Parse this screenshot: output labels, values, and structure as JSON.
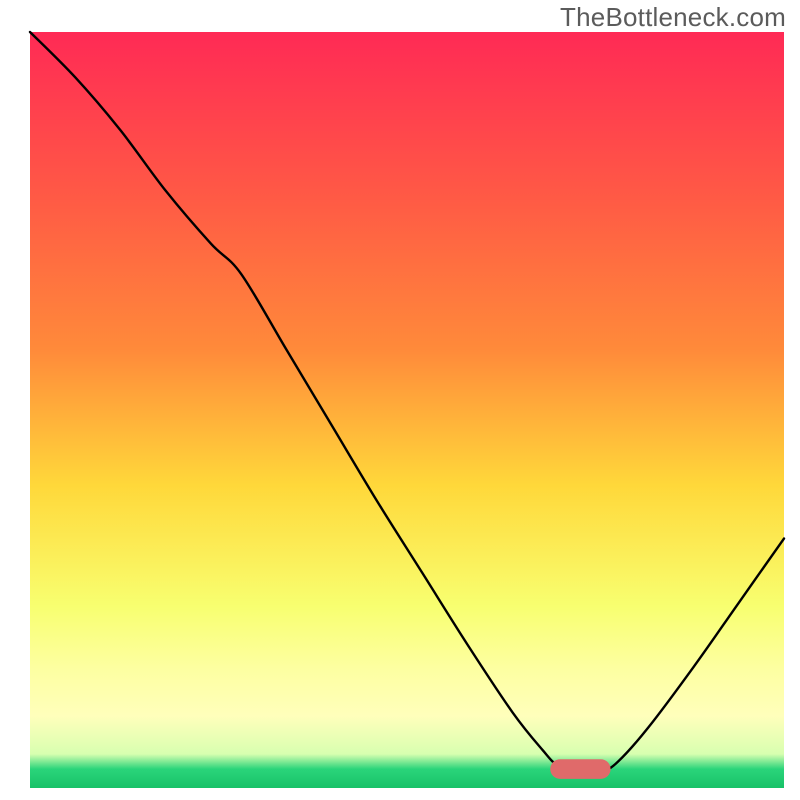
{
  "watermark": "TheBottleneck.com",
  "chart_data": {
    "type": "line",
    "title": "",
    "xlabel": "",
    "ylabel": "",
    "xlim": [
      0,
      100
    ],
    "ylim": [
      0,
      100
    ],
    "grid": false,
    "axes_visible": false,
    "background_gradient": {
      "top_color": "#ff2a55",
      "upper_mid_color": "#ff8a3a",
      "mid_color": "#ffd83a",
      "lower_mid_color": "#f8ff70",
      "pale_band_color": "#ffffbb",
      "thin_green_color": "#2ad47a",
      "bottom_band_color": "#18c268"
    },
    "marker": {
      "x": 73,
      "y": 2.5,
      "width": 8,
      "height": 2.6,
      "color": "#e06a6a",
      "rounded": true
    },
    "series": [
      {
        "name": "curve",
        "color": "#000000",
        "stroke_width": 2.4,
        "x": [
          0,
          6,
          12,
          18,
          24,
          28,
          34,
          40,
          46,
          52,
          58,
          64,
          68,
          70,
          73,
          76,
          78,
          82,
          88,
          94,
          100
        ],
        "y": [
          100,
          94,
          87,
          79,
          72,
          68,
          58,
          48,
          38,
          28.5,
          19,
          10,
          5,
          3,
          2,
          2.3,
          3.5,
          8,
          16,
          24.5,
          33
        ]
      }
    ]
  }
}
